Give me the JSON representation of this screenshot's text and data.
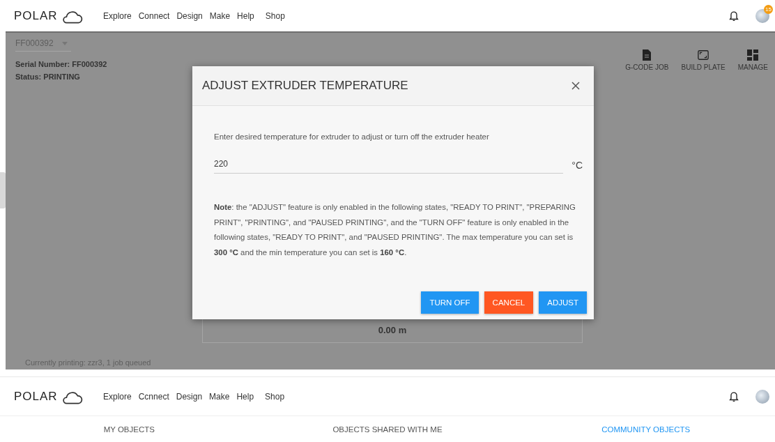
{
  "top_view": {
    "header": {
      "logo": "POLAR",
      "nav": [
        {
          "label": "Explore"
        },
        {
          "label": "Connect"
        },
        {
          "label": "Design"
        },
        {
          "label": "Make"
        },
        {
          "label": "Help"
        },
        {
          "label": "Shop"
        }
      ],
      "badge": "15"
    },
    "printer": {
      "selector": "FF000392",
      "serial": "Serial Number: FF000392",
      "status": "Status: PRINTING",
      "actions": [
        {
          "label": "G-CODE JOB",
          "kind": "file"
        },
        {
          "label": "BUILD PLATE",
          "kind": "plate"
        },
        {
          "label": "MANAGE",
          "kind": "dashboard"
        }
      ],
      "reading": "0.00 m",
      "footer": "Currently printing: zzr3, 1 job queued"
    },
    "dialog": {
      "title": "ADJUST EXTRUDER TEMPERATURE",
      "instruction": "Enter desired temperature for extruder to adjust or turn off the extruder heater",
      "temperature": {
        "value": "220",
        "unit": "°C"
      },
      "note": "**Note**: the \"ADJUST\" feature is only enabled in the following states, \"READY TO PRINT\", \"PREPARING PRINT\", \"PRINTING\", and \"PAUSED PRINTING\", and the \"TURN OFF\" feature is only enabled in the following states, \"READY TO PRINT\", and \"PAUSED PRINTING\". The max temperature you can set is **300 °C** and the min temperature you can set is **160 °C**.",
      "buttons": [
        {
          "label": "TURN OFF",
          "kind": "info"
        },
        {
          "label": "CANCEL",
          "kind": "danger"
        },
        {
          "label": "ADJUST",
          "kind": "primary"
        }
      ]
    }
  },
  "bottom_view": {
    "header": {
      "logo": "POLAR",
      "nav": [
        {
          "label": "Explore"
        },
        {
          "label": "Ccnnect"
        },
        {
          "label": "Design"
        },
        {
          "label": "Make"
        },
        {
          "label": "Help"
        },
        {
          "label": "Shop"
        }
      ]
    },
    "tabs": [
      {
        "label": "MY OBJECTS",
        "selected": false
      },
      {
        "label": "OBJECTS SHARED WITH ME",
        "selected": false
      },
      {
        "label": "COMMUNITY OBJECTS",
        "selected": true
      }
    ]
  }
}
